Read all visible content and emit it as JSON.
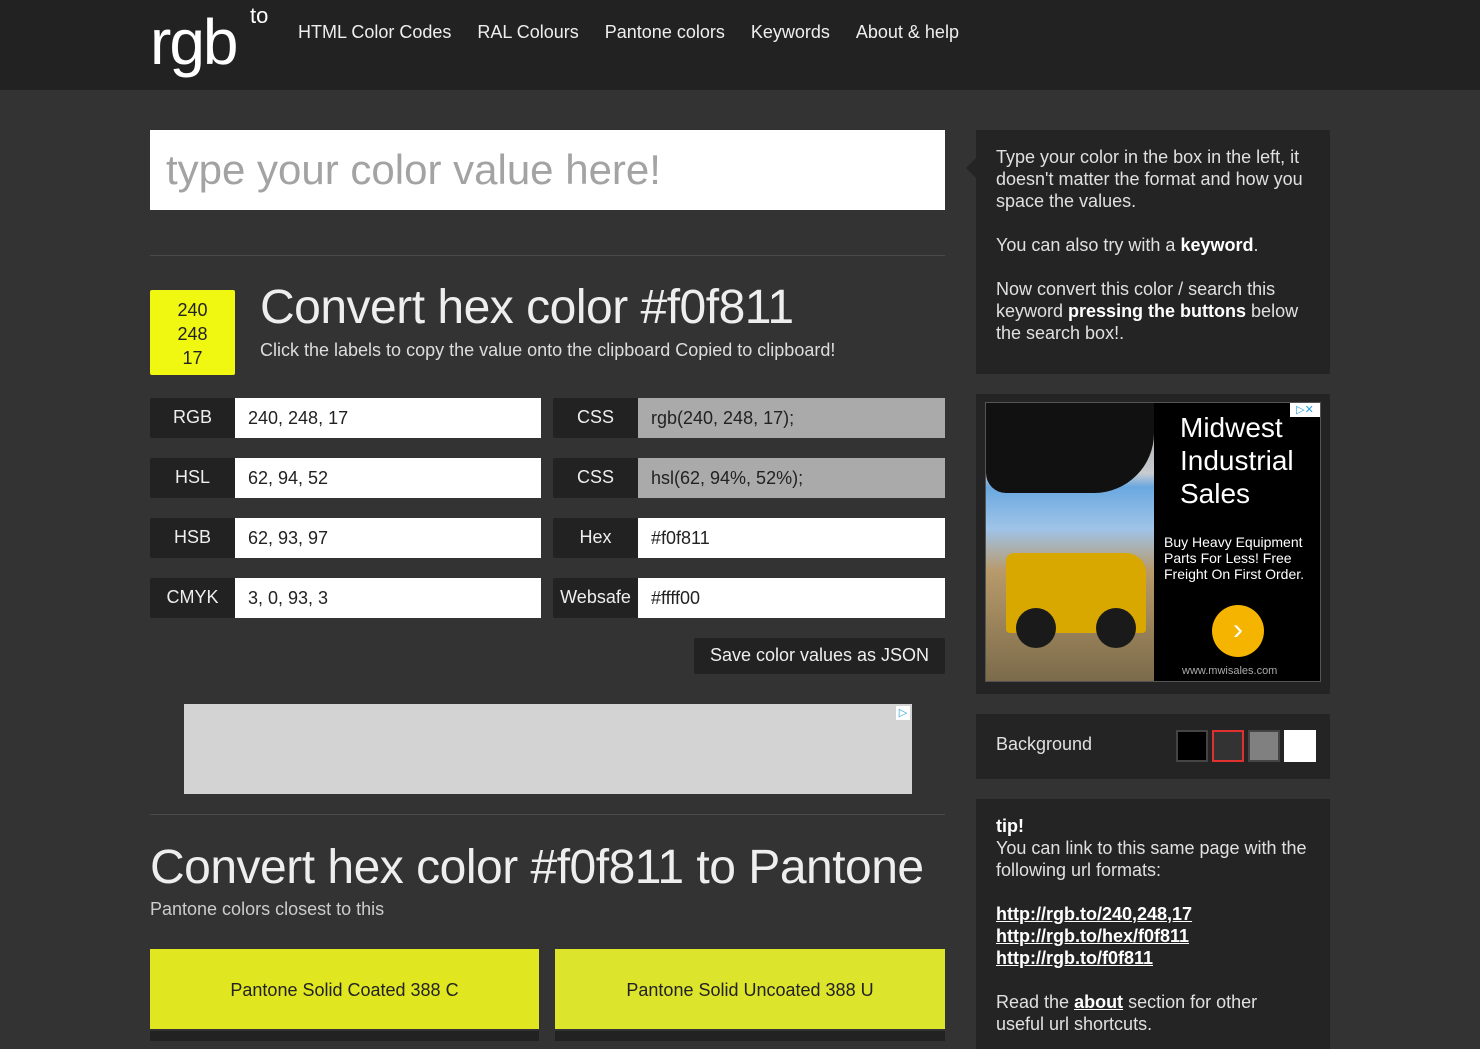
{
  "header": {
    "logo": "rgb",
    "logo_sup": "to",
    "nav": [
      "HTML Color Codes",
      "RAL Colours",
      "Pantone colors",
      "Keywords",
      "About & help"
    ]
  },
  "search": {
    "placeholder": "type your color value here!"
  },
  "color": {
    "hex": "#f0f811",
    "swatch_values": [
      "240",
      "248",
      "17"
    ],
    "title": "Convert hex color #f0f811",
    "subtitle": "Click the labels to copy the value onto the clipboard Copied to clipboard!"
  },
  "values": {
    "rgb": {
      "label": "RGB",
      "value": "240, 248, 17"
    },
    "hsl": {
      "label": "HSL",
      "value": "62, 94, 52"
    },
    "hsb": {
      "label": "HSB",
      "value": "62, 93, 97"
    },
    "cmyk": {
      "label": "CMYK",
      "value": "3, 0, 93, 3"
    },
    "css_rgb": {
      "label": "CSS",
      "value": "rgb(240, 248, 17);"
    },
    "css_hsl": {
      "label": "CSS",
      "value": "hsl(62, 94%, 52%);"
    },
    "hex": {
      "label": "Hex",
      "value": "#f0f811"
    },
    "websafe": {
      "label": "Websafe",
      "value": "#ffff00"
    }
  },
  "json_button": "Save color values as JSON",
  "pantone": {
    "title": "Convert hex color #f0f811 to Pantone",
    "subtitle": "Pantone colors closest to this",
    "items": [
      {
        "name": "Pantone Solid Coated 388 C",
        "color": "#e0e620"
      },
      {
        "name": "Pantone Solid Uncoated 388 U",
        "color": "#dde42c"
      }
    ]
  },
  "help": {
    "p1": "Type your color in the box in the left, it doesn't matter the format and how you space the values.",
    "p2_pre": "You can also try with a ",
    "p2_bold": "keyword",
    "p2_post": ".",
    "p3_pre": "Now convert this color / search this keyword ",
    "p3_bold": "pressing the buttons",
    "p3_post": " below the search box!."
  },
  "ad": {
    "headline": "Midwest Industrial Sales",
    "body": "Buy Heavy Equipment Parts For Less! Free Freight On First Order.",
    "url": "www.mwisales.com"
  },
  "background": {
    "label": "Background",
    "swatches": [
      "#000000",
      "#333333",
      "#808080",
      "#ffffff"
    ],
    "selected_index": 1,
    "selected_border": "#e03030"
  },
  "tip": {
    "heading": "tip!",
    "intro": "You can link to this same page with the following url formats:",
    "links": [
      "http://rgb.to/240,248,17",
      "http://rgb.to/hex/f0f811",
      "http://rgb.to/f0f811"
    ],
    "outro_pre": "Read the ",
    "outro_link": "about",
    "outro_post": " section for other useful url shortcuts."
  }
}
